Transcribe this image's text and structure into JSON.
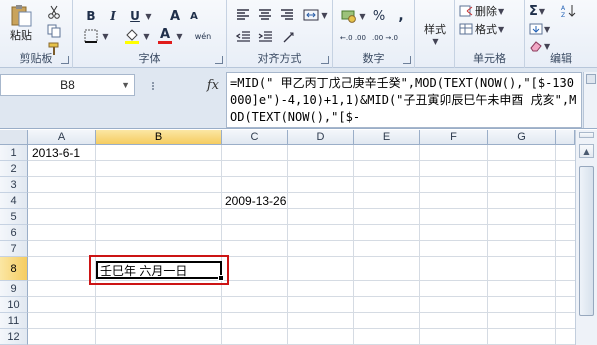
{
  "ribbon": {
    "clipboard": {
      "paste_label": "粘贴",
      "group_label": "剪贴板"
    },
    "font": {
      "group_label": "字体",
      "bold": "B",
      "italic": "I",
      "underline": "U",
      "grow": "A",
      "shrink": "A",
      "phonetic": "wén"
    },
    "alignment": {
      "group_label": "对齐方式"
    },
    "number": {
      "group_label": "数字",
      "percent": "%",
      "comma": ",",
      "inc_decimal": "←.0 .00",
      "dec_decimal": ".00 →.0"
    },
    "styles": {
      "label": "样式"
    },
    "cells": {
      "group_label": "单元格",
      "delete_label": "删除",
      "format_label": "格式"
    },
    "editing": {
      "group_label": "编辑"
    }
  },
  "formula_bar": {
    "name_box": "B8",
    "fx": "fx",
    "formula": "=MID(\" 甲乙丙丁戊己庚辛壬癸\",MOD(TEXT(NOW(),\"[$-130000]e\")-4,10)+1,1)&MID(\"子丑寅卯辰巳午未申酉 戌亥\",MOD(TEXT(NOW(),\"[$-"
  },
  "grid": {
    "columns": [
      "A",
      "B",
      "C",
      "D",
      "E",
      "F",
      "G"
    ],
    "rows": [
      "1",
      "2",
      "3",
      "4",
      "5",
      "6",
      "7",
      "8",
      "9",
      "10",
      "11",
      "12"
    ],
    "selected_column": "B",
    "selected_row": "8",
    "cells": {
      "A1": "2013-6-1",
      "C4": "2009-13-26",
      "B8": "壬巳年 六月一日"
    }
  },
  "colors": {
    "highlight_box": "#cc1414",
    "selected_header": "#f5cc61"
  }
}
